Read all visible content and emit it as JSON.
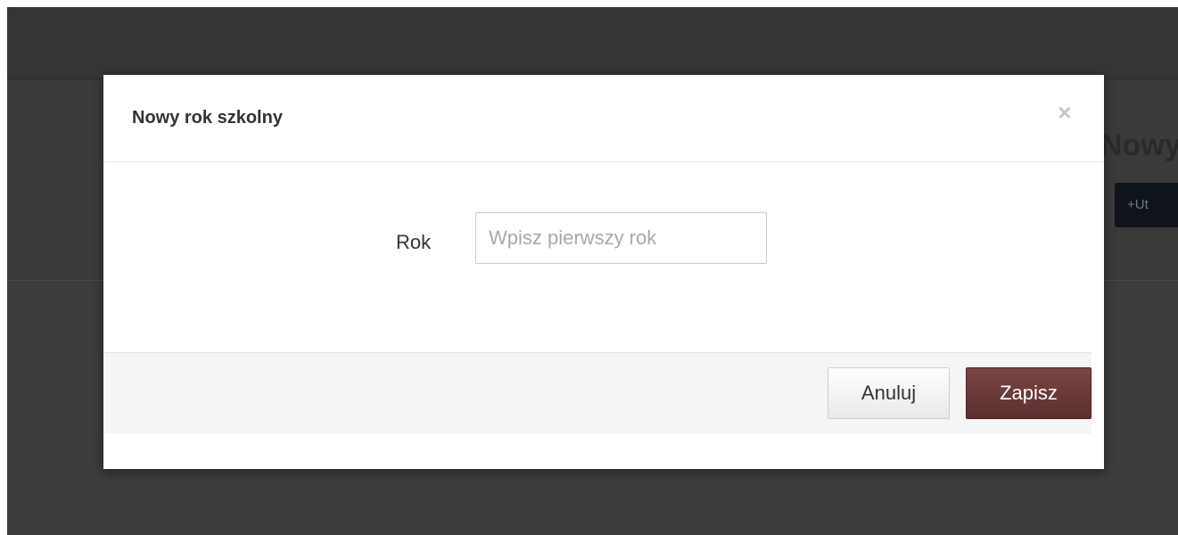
{
  "background": {
    "heading_partial": "Nowy",
    "button_partial": "Ut",
    "button_icon": "plus-icon"
  },
  "modal": {
    "title": "Nowy rok szkolny",
    "close_label": "×",
    "close_icon": "close-icon",
    "field": {
      "label": "Rok",
      "value": "",
      "placeholder": "Wpisz pierwszy rok"
    },
    "footer": {
      "cancel_label": "Anuluj",
      "save_label": "Zapisz"
    }
  },
  "colors": {
    "overlay": "#3c3c3c",
    "primary_button": "#6b3a3a",
    "close_icon": "#c4c4c4"
  }
}
